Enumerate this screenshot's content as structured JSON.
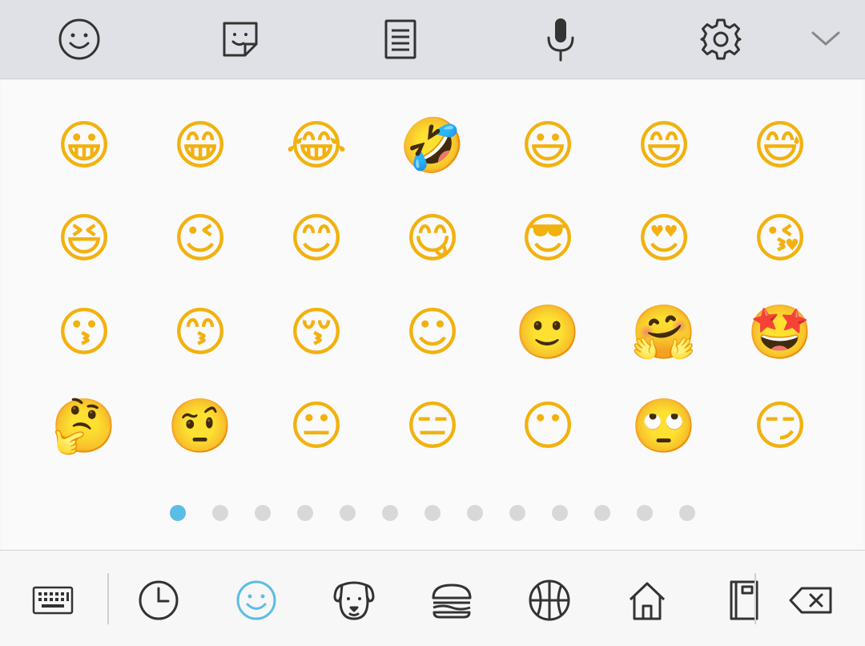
{
  "toolbar": {
    "icons": [
      "emoji-icon",
      "sticker-icon",
      "clipboard-icon",
      "microphone-icon",
      "settings-icon",
      "collapse-chevron-icon"
    ]
  },
  "emoji_grid": {
    "rows": [
      [
        "😀",
        "😁",
        "😂",
        "🤣",
        "😃",
        "😄",
        "😅"
      ],
      [
        "😆",
        "😉",
        "😊",
        "😋",
        "😎",
        "😍",
        "😘"
      ],
      [
        "😗",
        "😙",
        "😚",
        "☺",
        "🙂",
        "🤗",
        "🤩"
      ],
      [
        "🤔",
        "🤨",
        "😐",
        "😑",
        "😶",
        "🙄",
        "😏"
      ]
    ]
  },
  "pagination": {
    "total_pages": 13,
    "active_page": 1
  },
  "bottom_bar": {
    "icons": [
      "keyboard-icon",
      "recent-icon",
      "smileys-icon",
      "animals-icon",
      "food-icon",
      "sports-icon",
      "places-icon",
      "objects-icon",
      "backspace-icon"
    ],
    "active": "smileys-icon"
  },
  "colors": {
    "accent": "#5bbde6",
    "icon": "#333333",
    "toolbar_bg": "#e0e1e6",
    "emoji_yellow": "#f2b10e"
  }
}
